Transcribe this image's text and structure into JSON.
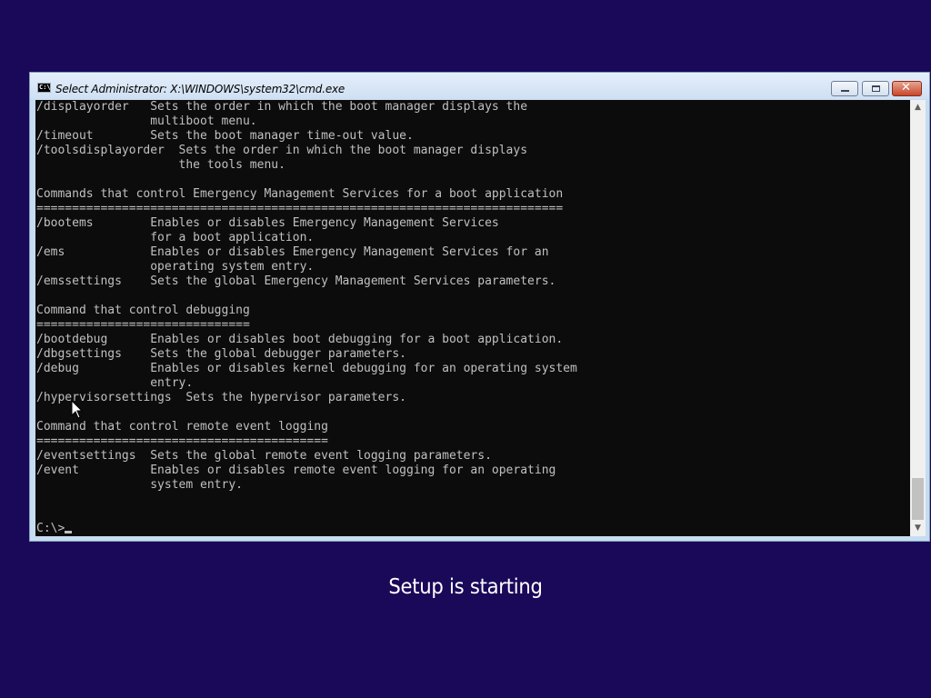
{
  "window": {
    "title": "Select Administrator: X:\\WINDOWS\\system32\\cmd.exe",
    "icon_name": "cmd-icon",
    "icon_text": "C:\\",
    "buttons": [
      "minimize",
      "maximize",
      "close"
    ],
    "close_glyph": "✕"
  },
  "console": {
    "lines": [
      "/displayorder   Sets the order in which the boot manager displays the",
      "                multiboot menu.",
      "/timeout        Sets the boot manager time-out value.",
      "/toolsdisplayorder  Sets the order in which the boot manager displays",
      "                    the tools menu.",
      "",
      "Commands that control Emergency Management Services for a boot application",
      "==========================================================================",
      "/bootems        Enables or disables Emergency Management Services",
      "                for a boot application.",
      "/ems            Enables or disables Emergency Management Services for an",
      "                operating system entry.",
      "/emssettings    Sets the global Emergency Management Services parameters.",
      "",
      "Command that control debugging",
      "==============================",
      "/bootdebug      Enables or disables boot debugging for a boot application.",
      "/dbgsettings    Sets the global debugger parameters.",
      "/debug          Enables or disables kernel debugging for an operating system",
      "                entry.",
      "/hypervisorsettings  Sets the hypervisor parameters.",
      "",
      "Command that control remote event logging",
      "=========================================",
      "/eventsettings  Sets the global remote event logging parameters.",
      "/event          Enables or disables remote event logging for an operating",
      "                system entry.",
      "",
      ""
    ],
    "prompt": "C:\\>"
  },
  "scrollbar": {
    "up_glyph": "▲",
    "down_glyph": "▼"
  },
  "setup": {
    "status": "Setup is starting"
  },
  "colors": {
    "desktop": "#1a0859",
    "console_bg": "#0c0c0c",
    "console_text": "#c0c0c0",
    "window_frame": "#c6dcf1"
  }
}
